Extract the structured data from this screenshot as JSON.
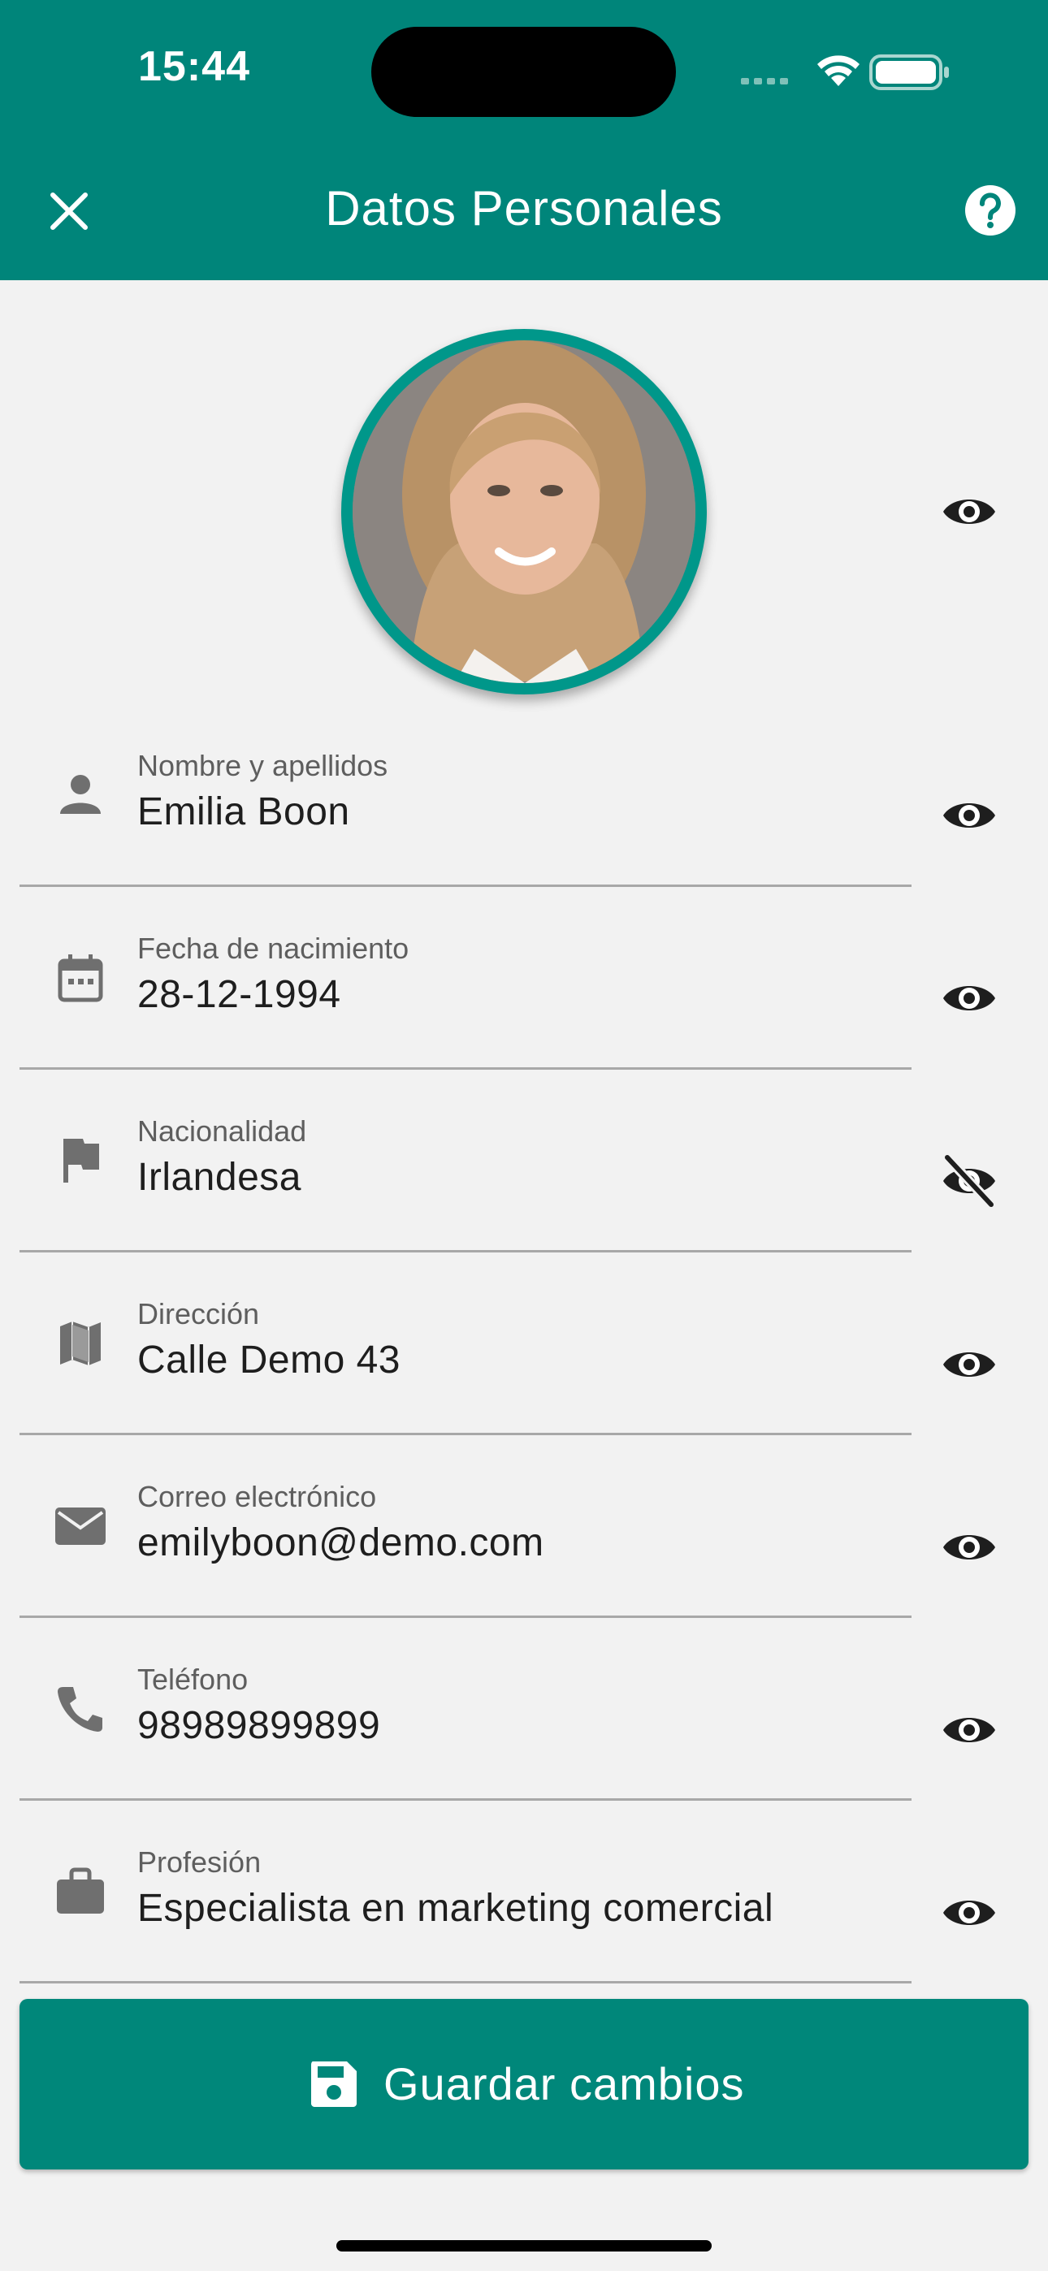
{
  "status_bar": {
    "time": "15:44"
  },
  "app_bar": {
    "title": "Datos Personales",
    "close_icon": "close-icon",
    "help_icon": "help-icon"
  },
  "profile": {
    "avatar": "avatar-photo",
    "visibility": "visible"
  },
  "fields": [
    {
      "label": "Nombre y apellidos",
      "value": "Emilia Boon",
      "icon": "person-icon",
      "visibility": "visible"
    },
    {
      "label": "Fecha de nacimiento",
      "value": "28-12-1994",
      "icon": "calendar-icon",
      "visibility": "visible"
    },
    {
      "label": "Nacionalidad",
      "value": "Irlandesa",
      "icon": "flag-icon",
      "visibility": "hidden"
    },
    {
      "label": "Dirección",
      "value": "Calle Demo 43",
      "icon": "map-icon",
      "visibility": "visible"
    },
    {
      "label": "Correo electrónico",
      "value": "emilyboon@demo.com",
      "icon": "email-icon",
      "visibility": "visible"
    },
    {
      "label": "Teléfono",
      "value": "98989899899",
      "icon": "phone-icon",
      "visibility": "visible"
    },
    {
      "label": "Profesión",
      "value": "Especialista en marketing comercial",
      "icon": "briefcase-icon",
      "visibility": "visible"
    }
  ],
  "save_button": {
    "label": "Guardar cambios",
    "icon": "save-icon"
  },
  "colors": {
    "primary": "#00857a",
    "background": "#f2f2f2",
    "icon_grey": "#6f6f6f"
  }
}
